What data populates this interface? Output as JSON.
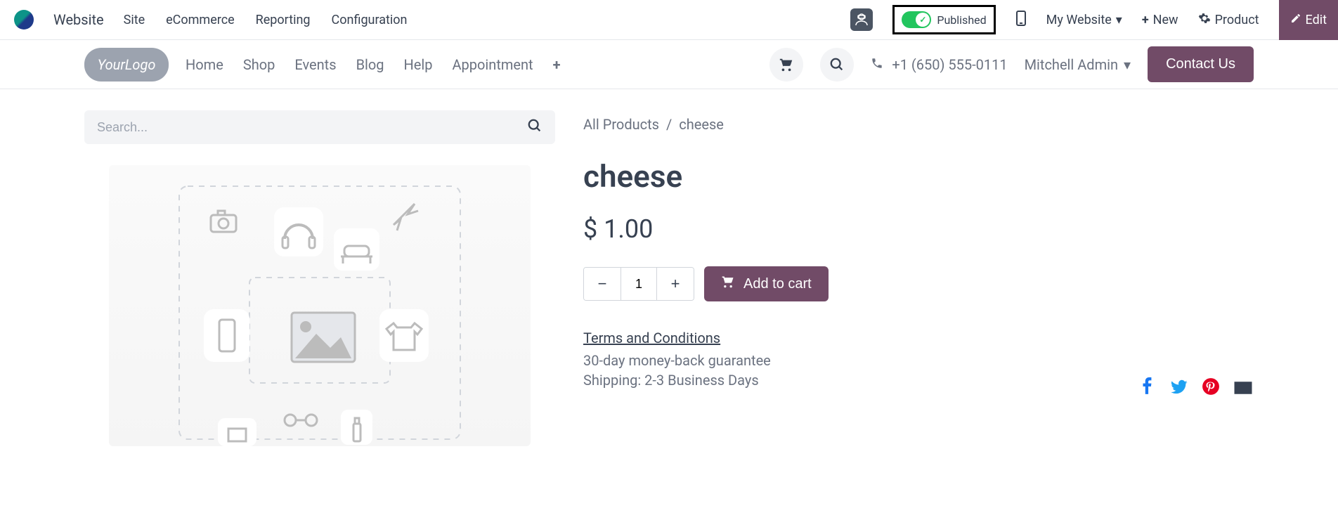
{
  "admin": {
    "title": "Website",
    "nav": [
      "Site",
      "eCommerce",
      "Reporting",
      "Configuration"
    ],
    "published_label": "Published",
    "my_website": "My Website",
    "new_label": "New",
    "product_label": "Product",
    "edit_label": "Edit"
  },
  "site_header": {
    "logo_text": "YourLogo",
    "nav": [
      "Home",
      "Shop",
      "Events",
      "Blog",
      "Help",
      "Appointment"
    ],
    "phone": "+1 (650) 555-0111",
    "user": "Mitchell Admin",
    "contact": "Contact Us"
  },
  "search": {
    "placeholder": "Search..."
  },
  "breadcrumb": {
    "root": "All Products",
    "current": "cheese"
  },
  "product": {
    "name": "cheese",
    "price": "$ 1.00",
    "quantity": "1",
    "add_to_cart": "Add to cart",
    "terms": "Terms and Conditions",
    "guarantee": "30-day money-back guarantee",
    "shipping": "Shipping: 2-3 Business Days"
  }
}
